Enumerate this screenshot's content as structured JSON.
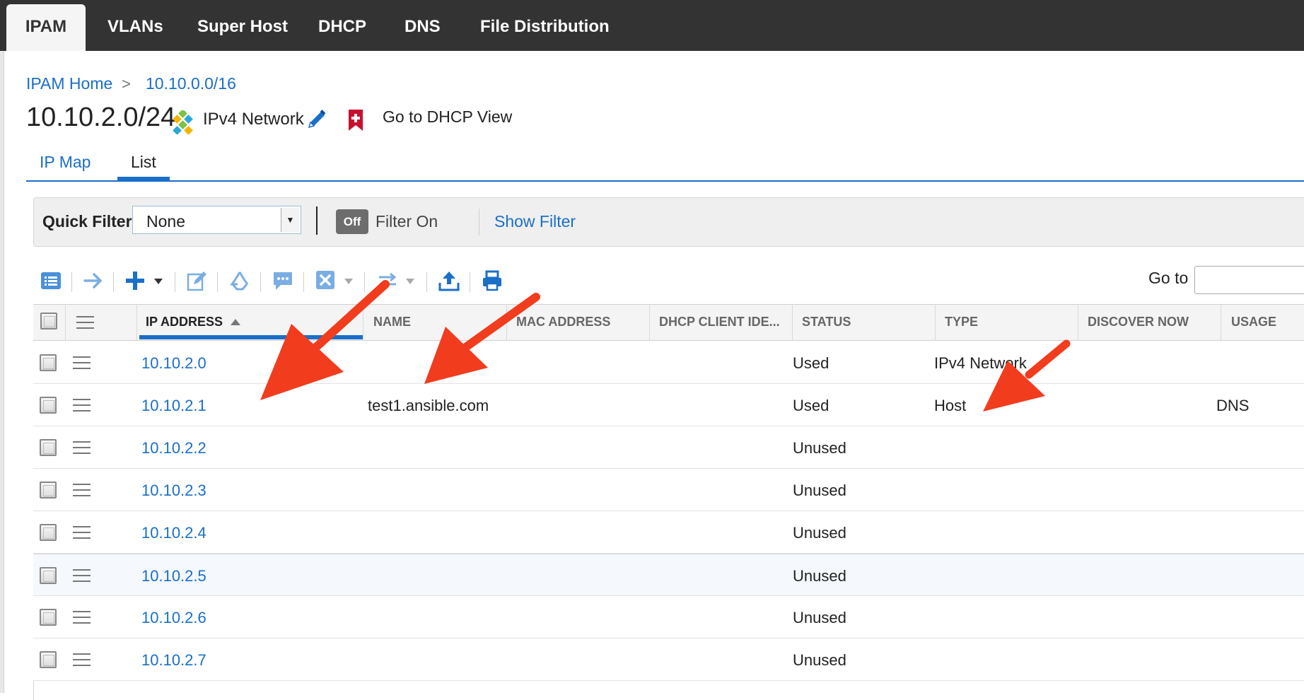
{
  "nav": {
    "tabs": [
      {
        "label": "IPAM",
        "active": true
      },
      {
        "label": "VLANs",
        "active": false
      },
      {
        "label": "Super Host",
        "active": false
      },
      {
        "label": "DHCP",
        "active": false
      },
      {
        "label": "DNS",
        "active": false
      },
      {
        "label": "File Distribution",
        "active": false
      }
    ]
  },
  "breadcrumb": {
    "home": "IPAM Home",
    "separator": ">",
    "parent": "10.10.0.0/16"
  },
  "header": {
    "title": "10.10.2.0/24",
    "network_type": "IPv4 Network",
    "dhcp_link": "Go to DHCP View",
    "icons": [
      "network-icon",
      "pencil-icon",
      "bookmark-icon"
    ]
  },
  "view_tabs": {
    "ip_map": "IP Map",
    "list": "List",
    "active": "List"
  },
  "filter": {
    "quick_filter_label": "Quick Filter",
    "quick_filter_value": "None",
    "toggle_label": "Off",
    "filter_on_label": "Filter On",
    "show_filter_label": "Show Filter"
  },
  "toolbar": {
    "icons": [
      "list-icon",
      "arrow-right-icon",
      "add-icon",
      "edit-icon",
      "recycle-icon",
      "comment-icon",
      "delete-icon",
      "swap-icon",
      "upload-icon",
      "print-icon"
    ],
    "goto_label": "Go to",
    "goto_value": ""
  },
  "grid": {
    "columns": [
      "IP ADDRESS",
      "NAME",
      "MAC ADDRESS",
      "DHCP CLIENT IDE...",
      "STATUS",
      "TYPE",
      "DISCOVER NOW",
      "USAGE"
    ],
    "sorted_column": "IP ADDRESS",
    "sort_direction": "ascending",
    "rows": [
      {
        "ip": "10.10.2.0",
        "name": "",
        "status": "Used",
        "type": "IPv4 Network",
        "usage": ""
      },
      {
        "ip": "10.10.2.1",
        "name": "test1.ansible.com",
        "status": "Used",
        "type": "Host",
        "usage": "DNS"
      },
      {
        "ip": "10.10.2.2",
        "name": "",
        "status": "Unused",
        "type": "",
        "usage": ""
      },
      {
        "ip": "10.10.2.3",
        "name": "",
        "status": "Unused",
        "type": "",
        "usage": ""
      },
      {
        "ip": "10.10.2.4",
        "name": "",
        "status": "Unused",
        "type": "",
        "usage": ""
      },
      {
        "ip": "10.10.2.5",
        "name": "",
        "status": "Unused",
        "type": "",
        "usage": ""
      },
      {
        "ip": "10.10.2.6",
        "name": "",
        "status": "Unused",
        "type": "",
        "usage": ""
      },
      {
        "ip": "10.10.2.7",
        "name": "",
        "status": "Unused",
        "type": "",
        "usage": ""
      }
    ]
  },
  "colors": {
    "accent": "#1a6fc9",
    "nav_bg": "#333333",
    "annotation_arrow": "#f23c1e",
    "bookmark": "#c8102e"
  }
}
